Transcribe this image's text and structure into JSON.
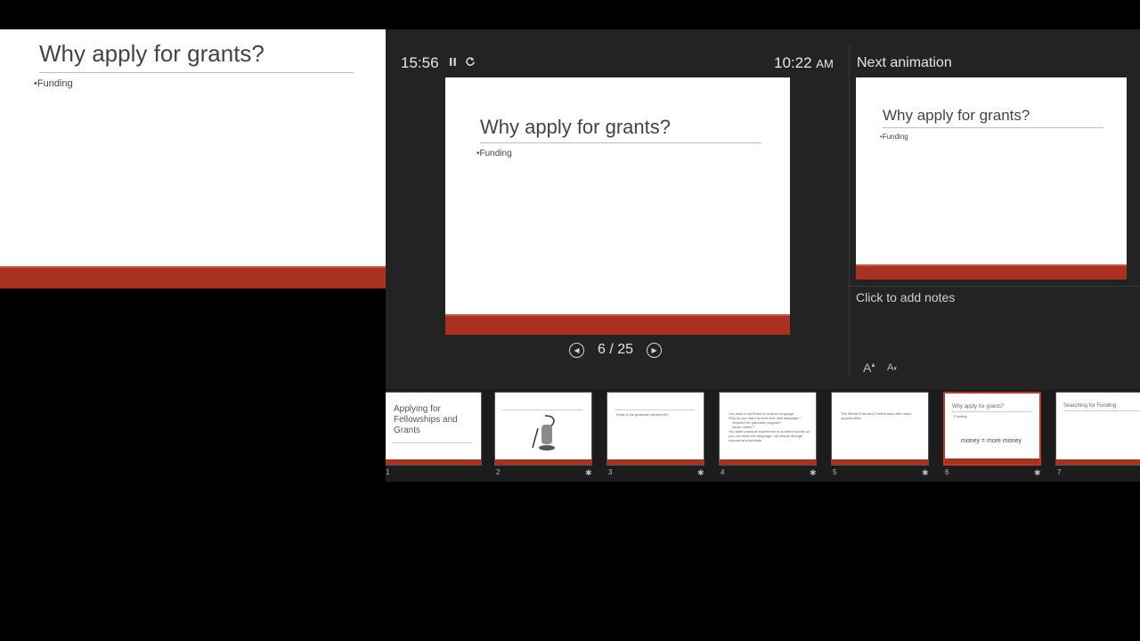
{
  "projected": {
    "title": "Why apply for grants?",
    "bullet": "Funding"
  },
  "presenter": {
    "timer": "15:56",
    "clock_time": "10:22",
    "clock_ampm": "AM",
    "pause_icon": "pause-icon",
    "restart_icon": "restart-icon",
    "current_slide": {
      "title": "Why apply for grants?",
      "bullet": "Funding"
    },
    "counter": "6 / 25",
    "next_label": "Next animation",
    "next_slide": {
      "title": "Why apply for grants?",
      "bullet": "Funding"
    },
    "notes_placeholder": "Click to add notes",
    "font_increase": "A",
    "font_decrease": "A"
  },
  "thumbnails": [
    {
      "num": "1",
      "title_l1": "Applying for",
      "title_l2": "Fellowships and",
      "title_l3": "Grants",
      "starred": false
    },
    {
      "num": "2",
      "title": "",
      "starred": true
    },
    {
      "num": "3",
      "text": "What is the graduate student life?",
      "starred": true
    },
    {
      "num": "4",
      "l1": "You want to be fluent in another language",
      "l2": "Why do you want to learn this new language?",
      "l3": "required for graduate program?",
      "l4": "future career?",
      "l5": "You want practical experience in another country so you can learn the language, not simply through courses and tutorials",
      "starred": true
    },
    {
      "num": "5",
      "text": "The Middle East and Central Asia offer many opportunities",
      "starred": true
    },
    {
      "num": "6",
      "title": "Why apply for grants?",
      "l1": "Funding",
      "money": "money = more money",
      "starred": true
    },
    {
      "num": "7",
      "title": "Searching for Funding",
      "starred": false
    }
  ],
  "colors": {
    "accent": "#a83120",
    "panel": "#232323",
    "active_border": "#c0392b"
  }
}
